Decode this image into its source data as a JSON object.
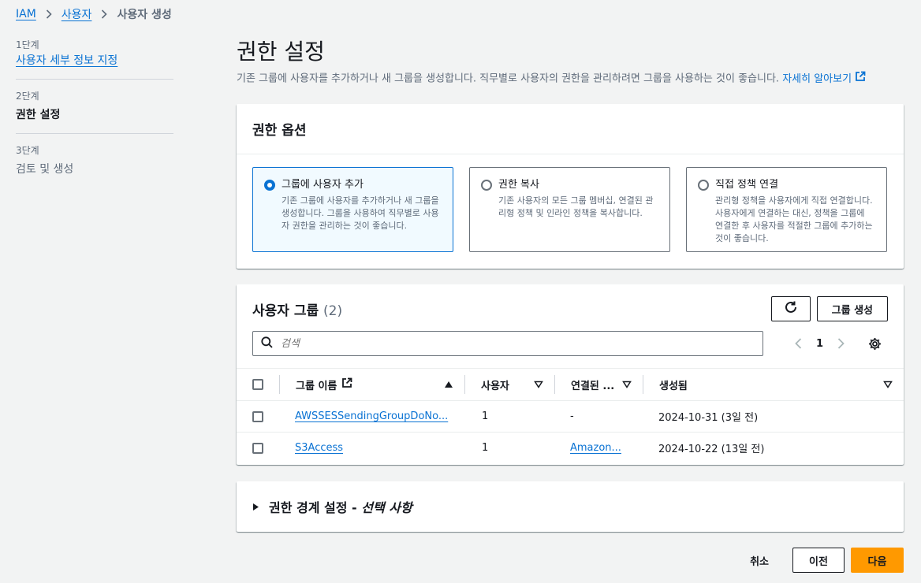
{
  "breadcrumb": {
    "items": [
      "IAM",
      "사용자"
    ],
    "current": "사용자 생성"
  },
  "steps": [
    {
      "num": "1단계",
      "title": "사용자 세부 정보 지정"
    },
    {
      "num": "2단계",
      "title": "권한 설정"
    },
    {
      "num": "3단계",
      "title": "검토 및 생성"
    }
  ],
  "page": {
    "title": "권한 설정",
    "description": "기존 그룹에 사용자를 추가하거나 새 그룹을 생성합니다. 직무별로 사용자의 권한을 관리하려면 그룹을 사용하는 것이 좋습니다.",
    "learn_more": "자세히 알아보기"
  },
  "permission_options": {
    "title": "권한 옵션",
    "options": [
      {
        "title": "그룹에 사용자 추가",
        "desc": "기존 그룹에 사용자를 추가하거나 새 그룹을 생성합니다. 그룹을 사용하여 직무별로 사용자 권한을 관리하는 것이 좋습니다.",
        "selected": true
      },
      {
        "title": "권한 복사",
        "desc": "기존 사용자의 모든 그룹 멤버십, 연결된 관리형 정책 및 인라인 정책을 복사합니다.",
        "selected": false
      },
      {
        "title": "직접 정책 연결",
        "desc": "관리형 정책을 사용자에게 직접 연결합니다. 사용자에게 연결하는 대신, 정책을 그룹에 연결한 후 사용자를 적절한 그룹에 추가하는 것이 좋습니다.",
        "selected": false
      }
    ]
  },
  "groups": {
    "title": "사용자 그룹",
    "count": "(2)",
    "create_label": "그룹 생성",
    "search_placeholder": "검색",
    "page": "1",
    "columns": [
      "그룹 이름",
      "사용자",
      "연결된 ...",
      "생성됨"
    ],
    "rows": [
      {
        "name": "AWSSESSendingGroupDoNo...",
        "users": "1",
        "policies": "-",
        "created": "2024-10-31 (3일 전)"
      },
      {
        "name": "S3Access",
        "users": "1",
        "policies": "Amazon...",
        "created": "2024-10-22 (13일 전)"
      }
    ]
  },
  "boundary": {
    "title": "권한 경계 설정 - ",
    "optional": "선택 사항"
  },
  "footer": {
    "cancel": "취소",
    "previous": "이전",
    "next": "다음"
  },
  "colors": {
    "link": "#0972d3",
    "primary": "#ff9900",
    "selected_bg": "#f1faff"
  }
}
